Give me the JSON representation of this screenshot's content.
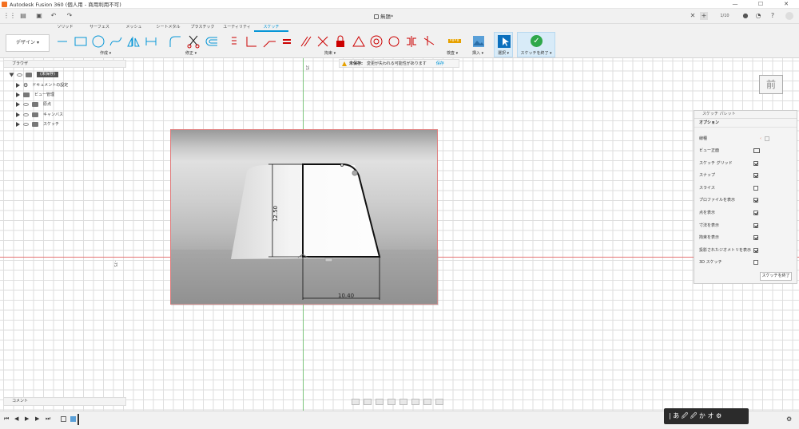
{
  "titlebar": {
    "title": "Autodesk Fusion 360 (個人用 - 商用利用不可)"
  },
  "document": {
    "name": "無題*",
    "job_status": "1/10"
  },
  "mode_tabs": [
    "ソリッド",
    "サーフェス",
    "メッシュ",
    "シートメタル",
    "プラスチック",
    "ユーティリティ",
    "スケッチ"
  ],
  "ribbon": {
    "workspace": "デザイン ▾",
    "groups": [
      "作成 ▾",
      "修正 ▾",
      "拘束 ▾",
      "検査 ▾",
      "挿入 ▾",
      "選択 ▾"
    ],
    "finish_label": "スケッチを終了 ▾"
  },
  "warning": {
    "title": "未保存:",
    "message": "変更が失われる可能性があります",
    "save": "保存"
  },
  "browser": {
    "title": "ブラウザ",
    "root": "(未保存)",
    "items": [
      "ドキュメントの設定",
      "ビュー管理",
      "原点",
      "キャンバス",
      "スケッチ"
    ]
  },
  "viewcube": {
    "face": "前"
  },
  "canvas": {
    "axis_h_label": "25",
    "axis_v_label": "-75"
  },
  "dimensions": {
    "height": "12.50",
    "width": "10.40"
  },
  "palette": {
    "title": "スケッチ パレット",
    "section": "オプション",
    "rows": [
      {
        "label": "線種",
        "type": "icons"
      },
      {
        "label": "ビュー正面",
        "type": "button"
      },
      {
        "label": "スケッチ グリッド",
        "checked": true
      },
      {
        "label": "スナップ",
        "checked": true
      },
      {
        "label": "スライス",
        "checked": false
      },
      {
        "label": "プロファイルを表示",
        "checked": true
      },
      {
        "label": "点を表示",
        "checked": true
      },
      {
        "label": "寸法を表示",
        "checked": true
      },
      {
        "label": "拘束を表示",
        "checked": true
      },
      {
        "label": "投影されたジオメトリを表示",
        "checked": true
      },
      {
        "label": "3D スケッチ",
        "checked": false
      }
    ],
    "finish": "スケッチを終了"
  },
  "comments": {
    "title": "コメント"
  },
  "ime": {
    "text": "| あ 🖉 🖉 か オ ⚙"
  }
}
